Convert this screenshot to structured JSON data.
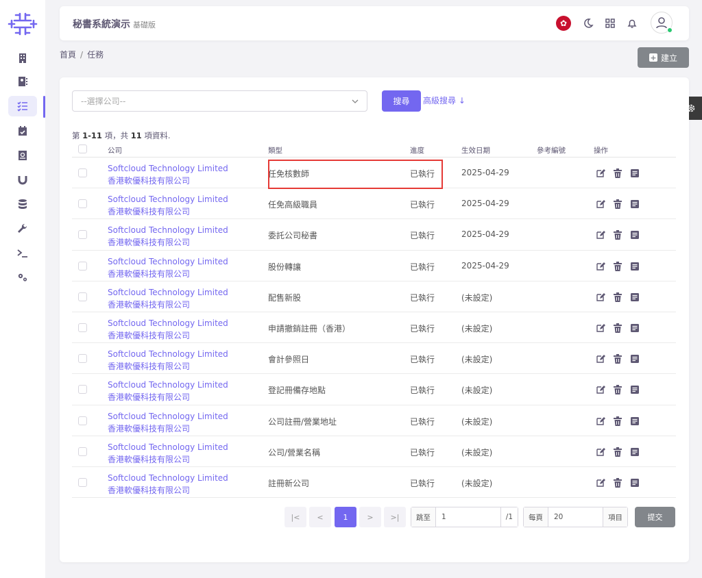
{
  "header": {
    "app_title": "秘書系統演示",
    "edition": "基礎版"
  },
  "breadcrumb": {
    "home": "首頁",
    "separator": "/",
    "current": "任務"
  },
  "actions": {
    "create_label": "建立"
  },
  "filters": {
    "company_placeholder": "--選擇公司--",
    "search_label": "搜尋",
    "advanced_search_label": "高級搜尋 ↓"
  },
  "summary": {
    "prefix": "第 ",
    "range": "1-11",
    "middle": " 項，共 ",
    "total": "11",
    "suffix": " 項資料."
  },
  "table": {
    "columns": [
      "公司",
      "類型",
      "進度",
      "生效日期",
      "參考編號",
      "操作"
    ],
    "rows": [
      {
        "company_en": "Softcloud Technology Limited",
        "company_zh": "香港軟優科技有限公司",
        "type": "任免核數師",
        "status": "已執行",
        "date": "2025-04-29",
        "ref": ""
      },
      {
        "company_en": "Softcloud Technology Limited",
        "company_zh": "香港軟優科技有限公司",
        "type": "任免高級職員",
        "status": "已執行",
        "date": "2025-04-29",
        "ref": ""
      },
      {
        "company_en": "Softcloud Technology Limited",
        "company_zh": "香港軟優科技有限公司",
        "type": "委託公司秘書",
        "status": "已執行",
        "date": "2025-04-29",
        "ref": ""
      },
      {
        "company_en": "Softcloud Technology Limited",
        "company_zh": "香港軟優科技有限公司",
        "type": "股份轉讓",
        "status": "已執行",
        "date": "2025-04-29",
        "ref": ""
      },
      {
        "company_en": "Softcloud Technology Limited",
        "company_zh": "香港軟優科技有限公司",
        "type": "配售新股",
        "status": "已執行",
        "date": "(未設定)",
        "ref": ""
      },
      {
        "company_en": "Softcloud Technology Limited",
        "company_zh": "香港軟優科技有限公司",
        "type": "申請撤銷註冊（香港）",
        "status": "已執行",
        "date": "(未設定)",
        "ref": ""
      },
      {
        "company_en": "Softcloud Technology Limited",
        "company_zh": "香港軟優科技有限公司",
        "type": "會計參照日",
        "status": "已執行",
        "date": "(未設定)",
        "ref": ""
      },
      {
        "company_en": "Softcloud Technology Limited",
        "company_zh": "香港軟優科技有限公司",
        "type": "登記冊備存地點",
        "status": "已執行",
        "date": "(未設定)",
        "ref": ""
      },
      {
        "company_en": "Softcloud Technology Limited",
        "company_zh": "香港軟優科技有限公司",
        "type": "公司註冊/營業地址",
        "status": "已執行",
        "date": "(未設定)",
        "ref": ""
      },
      {
        "company_en": "Softcloud Technology Limited",
        "company_zh": "香港軟優科技有限公司",
        "type": "公司/營業名稱",
        "status": "已執行",
        "date": "(未設定)",
        "ref": ""
      },
      {
        "company_en": "Softcloud Technology Limited",
        "company_zh": "香港軟優科技有限公司",
        "type": "註冊新公司",
        "status": "已執行",
        "date": "(未設定)",
        "ref": ""
      }
    ]
  },
  "pagination": {
    "first": "|<",
    "prev": "<",
    "current_page": "1",
    "next": ">",
    "last": ">|",
    "jump_label": "跳至",
    "jump_value": "1",
    "total_pages": "/1",
    "per_page_label": "每頁",
    "per_page_value": "20",
    "items_label": "項目",
    "submit_label": "提交"
  },
  "colors": {
    "accent": "#7367f0",
    "highlight_border": "#e53935",
    "status_online": "#28c76f"
  }
}
